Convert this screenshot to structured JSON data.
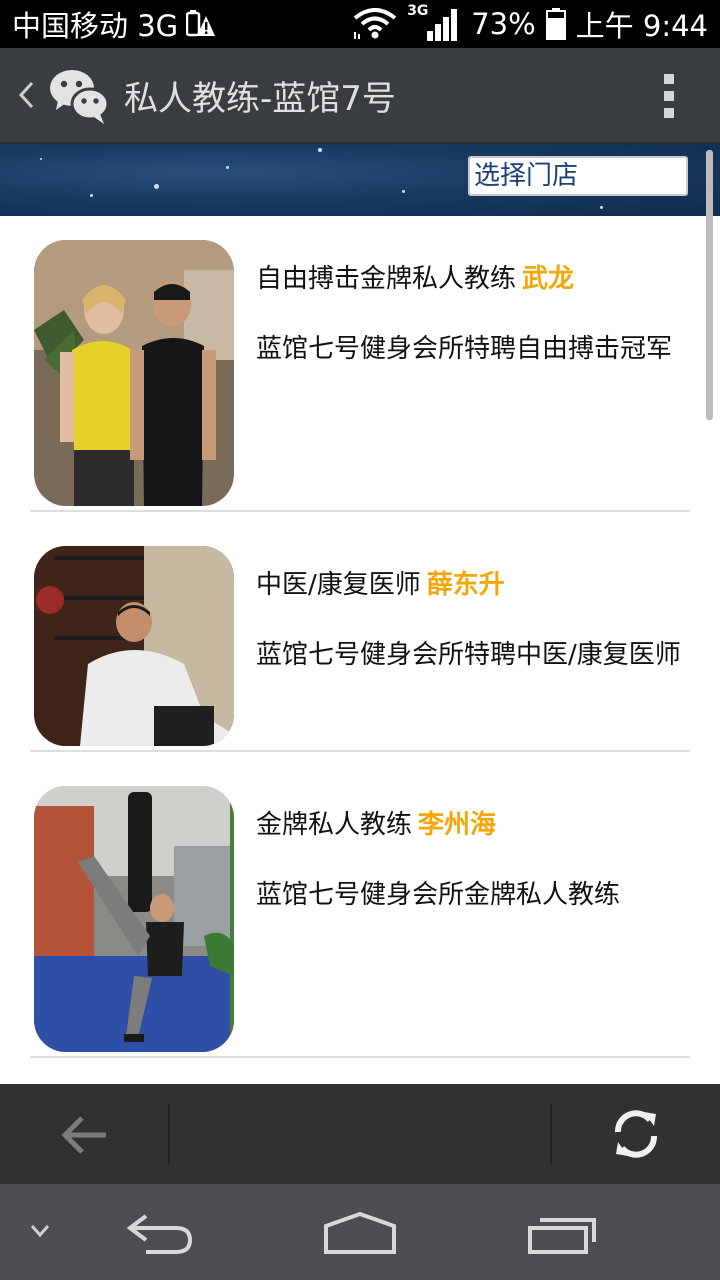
{
  "status_bar": {
    "carrier": "中国移动 3G",
    "network_type": "3G",
    "battery": "73%",
    "time": "上午 9:44",
    "icons": [
      "warning-icon",
      "wifi-icon",
      "signal-icon",
      "battery-icon"
    ]
  },
  "app_bar": {
    "title": "私人教练-蓝馆7号",
    "icons": [
      "back-chevron-icon",
      "wechat-icon",
      "overflow-menu-icon"
    ]
  },
  "banner": {
    "store_select_label": "选择门店"
  },
  "trainers": [
    {
      "role": "自由搏击金牌私人教练",
      "name": "武龙",
      "desc": "蓝馆七号健身会所特聘自由搏击冠军"
    },
    {
      "role": "中医/康复医师",
      "name": "薛东升",
      "desc": "蓝馆七号健身会所特聘中医/康复医师"
    },
    {
      "role": "金牌私人教练",
      "name": "李州海",
      "desc": "蓝馆七号健身会所金牌私人教练"
    }
  ],
  "colors": {
    "name_accent": "#f5a70a",
    "app_bar": "#3a3d40",
    "banner": "#183a62"
  },
  "toolbar": {
    "icons": [
      "back-arrow-icon",
      "refresh-icon"
    ]
  },
  "navbar": {
    "icons": [
      "hide-keyboard-icon",
      "back-icon",
      "home-icon",
      "recents-icon"
    ]
  }
}
